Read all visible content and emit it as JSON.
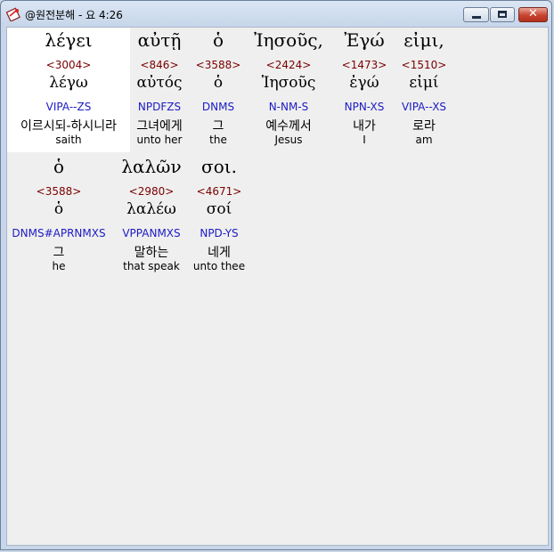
{
  "window": {
    "title": "@원전분해 - 요 4:26",
    "icons": {
      "app": "bible-app-icon",
      "minimize": "minimize-icon",
      "maximize": "maximize-icon",
      "close": "close-icon"
    },
    "close_label": "✕"
  },
  "words": [
    {
      "greek": "λέγει",
      "strong": "<3004>",
      "lemma": "λέγω",
      "morph": "VIPA--ZS",
      "korean": "이르시되-하시니라",
      "english": "saith"
    },
    {
      "greek": "αὐτῇ",
      "strong": "<846>",
      "lemma": "αὐτός",
      "morph": "NPDFZS",
      "korean": "그녀에게",
      "english": "unto her"
    },
    {
      "greek": "ὁ",
      "strong": "<3588>",
      "lemma": "ὁ",
      "morph": "DNMS",
      "korean": "그",
      "english": "the"
    },
    {
      "greek": "Ἰησοῦς,",
      "strong": "<2424>",
      "lemma": "Ἰησοῦς",
      "morph": "N-NM-S",
      "korean": "예수께서",
      "english": "Jesus"
    },
    {
      "greek": "Ἐγώ",
      "strong": "<1473>",
      "lemma": "ἐγώ",
      "morph": "NPN-XS",
      "korean": "내가",
      "english": "I"
    },
    {
      "greek": "εἰμι,",
      "strong": "<1510>",
      "lemma": "εἰμί",
      "morph": "VIPA--XS",
      "korean": "로라",
      "english": "am"
    },
    {
      "greek": "ὁ",
      "strong": "<3588>",
      "lemma": "ὁ",
      "morph": "DNMS#APRNMXS",
      "korean": "그",
      "english": "he"
    },
    {
      "greek": "λαλῶν",
      "strong": "<2980>",
      "lemma": "λαλέω",
      "morph": "VPPANMXS",
      "korean": "말하는",
      "english": "that speak"
    },
    {
      "greek": "σοι.",
      "strong": "<4671>",
      "lemma": "σοί",
      "morph": "NPD-YS",
      "korean": "네게",
      "english": "unto thee"
    }
  ]
}
